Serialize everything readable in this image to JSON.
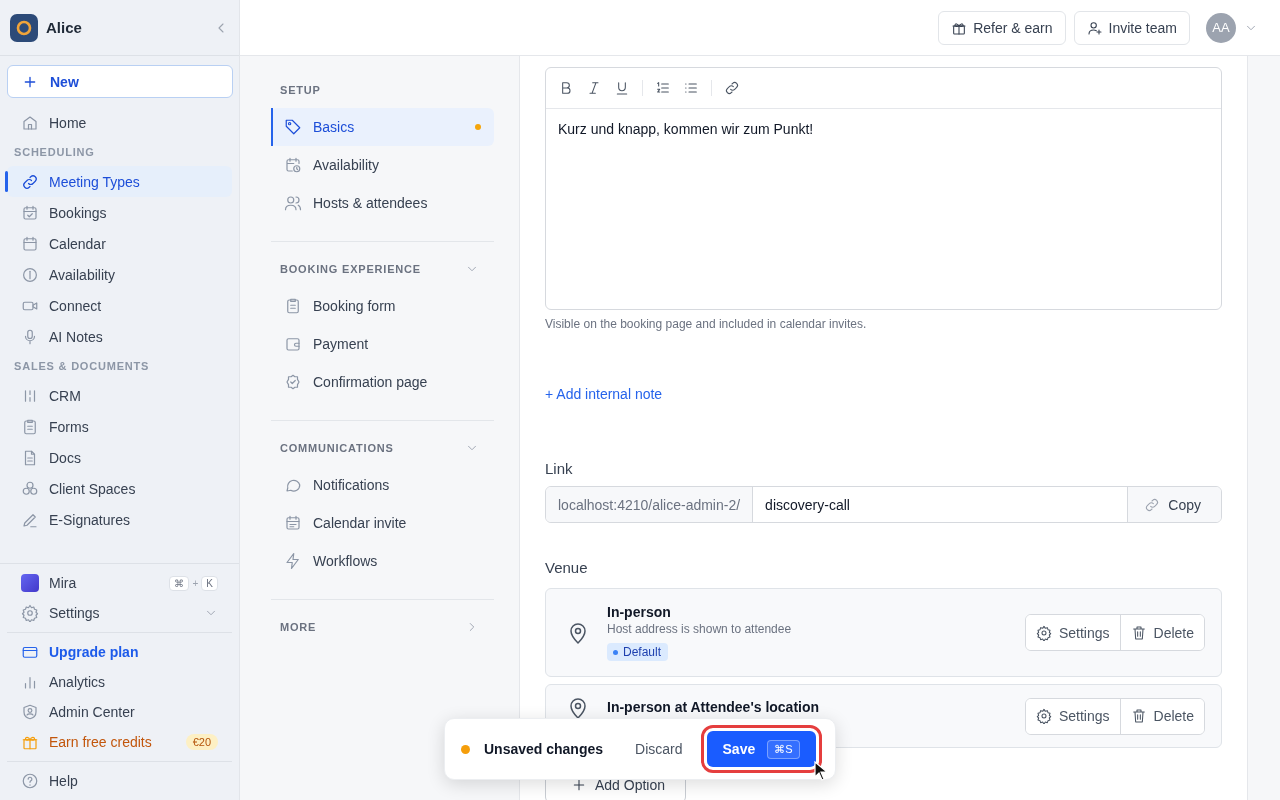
{
  "sidebar": {
    "workspace": "Alice",
    "new_button": "New",
    "nav": [
      {
        "kind": "item",
        "label": "Home",
        "selected": false
      },
      {
        "kind": "section",
        "label": "SCHEDULING"
      },
      {
        "kind": "item",
        "label": "Meeting Types",
        "selected": true
      },
      {
        "kind": "item",
        "label": "Bookings",
        "selected": false
      },
      {
        "kind": "item",
        "label": "Calendar",
        "selected": false
      },
      {
        "kind": "item",
        "label": "Availability",
        "selected": false
      },
      {
        "kind": "item",
        "label": "Connect",
        "selected": false
      },
      {
        "kind": "item",
        "label": "AI Notes",
        "selected": false
      },
      {
        "kind": "section",
        "label": "SALES & DOCUMENTS"
      },
      {
        "kind": "item",
        "label": "CRM",
        "selected": false
      },
      {
        "kind": "item",
        "label": "Forms",
        "selected": false
      },
      {
        "kind": "item",
        "label": "Docs",
        "selected": false
      },
      {
        "kind": "item",
        "label": "Client Spaces",
        "selected": false
      },
      {
        "kind": "item",
        "label": "E-Signatures",
        "selected": false
      }
    ],
    "bottom_groups": [
      [
        {
          "kind": "assistant",
          "label": "Mira",
          "shortcut": [
            {
              "kind": "key",
              "text": "⌘"
            },
            {
              "kind": "sep",
              "text": "+"
            },
            {
              "kind": "key",
              "text": "K"
            }
          ]
        },
        {
          "kind": "expandable",
          "label": "Settings",
          "expanded": false
        }
      ],
      [
        {
          "kind": "accent",
          "label": "Upgrade plan"
        },
        {
          "kind": "plain",
          "label": "Analytics"
        },
        {
          "kind": "plain",
          "label": "Admin Center"
        },
        {
          "kind": "promo",
          "label": "Earn free credits",
          "badge": "€20"
        }
      ],
      [
        {
          "kind": "plain",
          "label": "Help"
        }
      ]
    ]
  },
  "topbar": {
    "buttons": [
      {
        "label": "Refer & earn"
      },
      {
        "label": "Invite team"
      }
    ],
    "avatar": "AA"
  },
  "settings_nav": {
    "sections": [
      {
        "title": "SETUP",
        "items": [
          {
            "label": "Basics",
            "selected": true,
            "modified": true
          },
          {
            "label": "Availability",
            "selected": false,
            "modified": false
          },
          {
            "label": "Hosts & attendees",
            "selected": false,
            "modified": false
          }
        ]
      },
      {
        "title": "BOOKING EXPERIENCE",
        "expanded": true,
        "items": [
          {
            "label": "Booking form",
            "selected": false,
            "modified": false
          },
          {
            "label": "Payment",
            "selected": false,
            "modified": false
          },
          {
            "label": "Confirmation page",
            "selected": false,
            "modified": false
          }
        ]
      },
      {
        "title": "COMMUNICATIONS",
        "expanded": true,
        "items": [
          {
            "label": "Notifications",
            "selected": false,
            "modified": false
          },
          {
            "label": "Calendar invite",
            "selected": false,
            "modified": false
          },
          {
            "label": "Workflows",
            "selected": false,
            "modified": false
          }
        ]
      },
      {
        "title": "MORE",
        "expanded": false
      }
    ]
  },
  "content": {
    "description": {
      "value": "Kurz und knapp, kommen wir zum Punkt!",
      "hint": "Visible on the booking page and included in calendar invites."
    },
    "internal_note_link": "+ Add internal note",
    "link": {
      "label": "Link",
      "prefix": "localhost:4210/alice-admin-2/",
      "value": "discovery-call",
      "copy_button": "Copy"
    },
    "venue": {
      "label": "Venue",
      "options": [
        {
          "title": "In-person",
          "subtitle": "Host address is shown to attendee",
          "badge": "Default",
          "settings_button": "Settings",
          "delete_button": "Delete"
        },
        {
          "title": "In-person at Attendee's location",
          "settings_button": "Settings",
          "delete_button": "Delete"
        }
      ],
      "add_button": "Add Option"
    }
  },
  "unsaved_bar": {
    "message": "Unsaved changes",
    "discard": "Discard",
    "save": "Save",
    "save_shortcut": "⌘S",
    "save_focused": true
  }
}
